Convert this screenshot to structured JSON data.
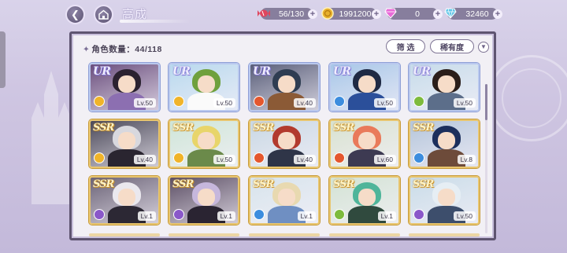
{
  "header": {
    "title": "高成",
    "resources": [
      {
        "name": "stamina",
        "value": "56/130",
        "icon": "candy-icon",
        "color": "#e0455d"
      },
      {
        "name": "coins",
        "value": "1991200",
        "icon": "coin-icon",
        "color": "#e7b02c"
      },
      {
        "name": "gems",
        "value": "0",
        "icon": "pink-gem-icon",
        "color": "#e86ad8"
      },
      {
        "name": "diamonds",
        "value": "32460",
        "icon": "diamond-icon",
        "color": "#63c7e8"
      }
    ]
  },
  "panel": {
    "count_label": "角色数量：44/118",
    "filter_label": "筛 选",
    "rarity_label": "稀有度"
  },
  "cards": [
    {
      "rarity": "UR",
      "level": "Lv.50",
      "attr_color": "#f0b429",
      "palette": [
        "#6b4f7e",
        "#2b2230",
        "#8c6fb1"
      ]
    },
    {
      "rarity": "UR",
      "level": "Lv.50",
      "attr_color": "#f0b429",
      "palette": [
        "#b9d9ee",
        "#6fa03c",
        "#fafafa"
      ]
    },
    {
      "rarity": "UR",
      "level": "Lv.40",
      "attr_color": "#e4572e",
      "palette": [
        "#5a5f7a",
        "#2f3d52",
        "#8b5a36"
      ]
    },
    {
      "rarity": "UR",
      "level": "Lv.50",
      "attr_color": "#3c8dde",
      "palette": [
        "#a8c7e8",
        "#1f2a44",
        "#2b4f9a"
      ]
    },
    {
      "rarity": "UR",
      "level": "Lv.50",
      "attr_color": "#7dbb3c",
      "palette": [
        "#c7dcea",
        "#2a1e1a",
        "#5c6e8a"
      ]
    },
    {
      "rarity": "SSR",
      "level": "Lv.40",
      "attr_color": "#f0b429",
      "palette": [
        "#4c4a5a",
        "#d8d8de",
        "#2a2530"
      ]
    },
    {
      "rarity": "SSR",
      "level": "Lv.50",
      "attr_color": "#f0b429",
      "palette": [
        "#cfe6d8",
        "#e8d56a",
        "#6b8a4a"
      ]
    },
    {
      "rarity": "SSR",
      "level": "Lv.40",
      "attr_color": "#e4572e",
      "palette": [
        "#c9d8e4",
        "#b23a2e",
        "#2f3548"
      ]
    },
    {
      "rarity": "SSR",
      "level": "Lv.60",
      "attr_color": "#e4572e",
      "palette": [
        "#d8e2d0",
        "#e97a5a",
        "#3d3a52"
      ]
    },
    {
      "rarity": "SSR",
      "level": "Lv.8",
      "attr_color": "#3c8dde",
      "palette": [
        "#b5c6db",
        "#1c2f5c",
        "#6d4b3a"
      ]
    },
    {
      "rarity": "SSR",
      "level": "Lv.1",
      "attr_color": "#8a58c9",
      "palette": [
        "#6c6478",
        "#eae8ee",
        "#2c2834"
      ]
    },
    {
      "rarity": "SSR",
      "level": "Lv.1",
      "attr_color": "#8a58c9",
      "palette": [
        "#5d5066",
        "#c6b7dc",
        "#2a2432"
      ]
    },
    {
      "rarity": "SSR",
      "level": "Lv.1",
      "attr_color": "#3c8dde",
      "palette": [
        "#d7e4ec",
        "#e8d9b0",
        "#6f8fc2"
      ]
    },
    {
      "rarity": "SSR",
      "level": "Lv.1",
      "attr_color": "#7dbb3c",
      "palette": [
        "#d3e3d4",
        "#4fb59a",
        "#304a3e"
      ]
    },
    {
      "rarity": "SSR",
      "level": "Lv.50",
      "attr_color": "#8a58c9",
      "palette": [
        "#c9dce8",
        "#e6eef4",
        "#3d4e6c"
      ]
    }
  ]
}
